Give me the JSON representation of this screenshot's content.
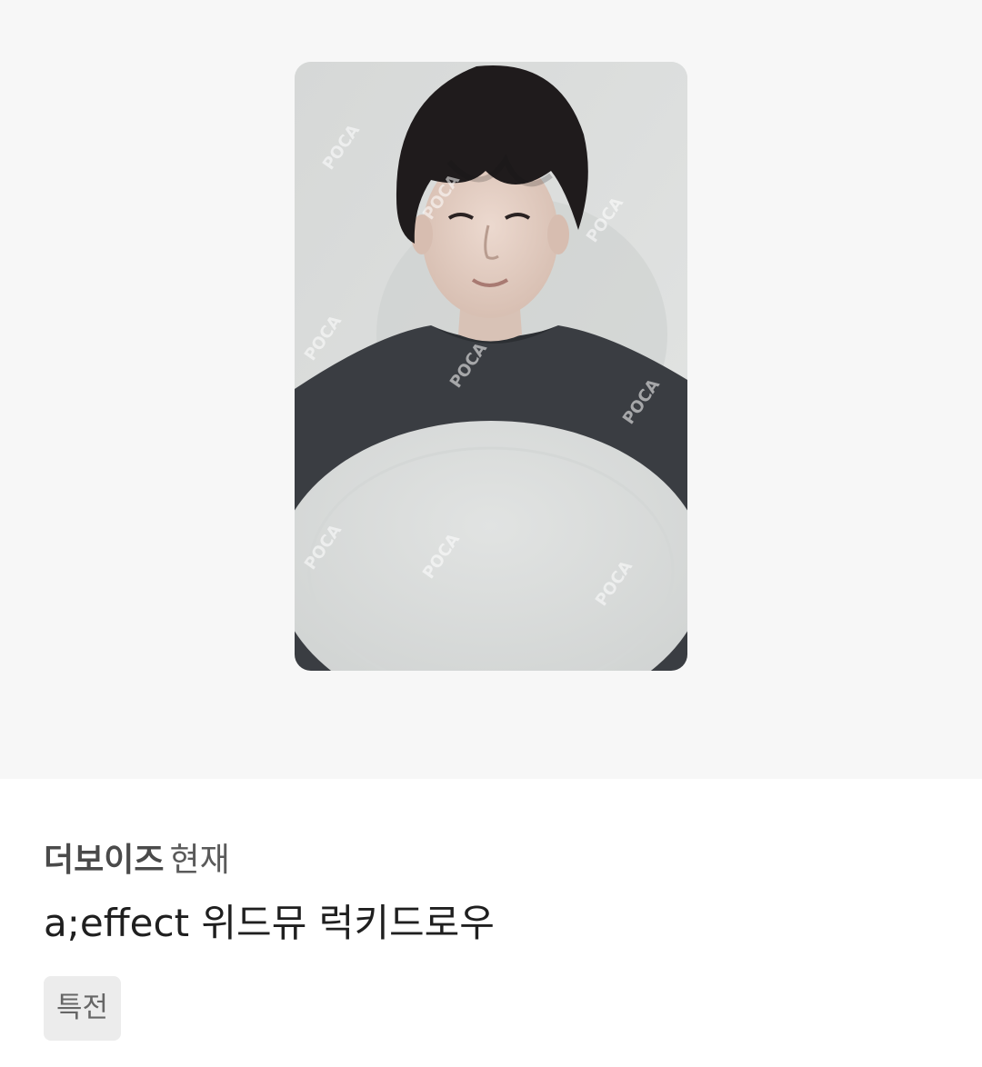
{
  "product": {
    "artist": "더보이즈",
    "member": "현재",
    "title": "a;effect 위드뮤 럭키드로우",
    "tags": [
      "특전"
    ]
  },
  "image": {
    "subject": "photocard",
    "watermark_text": "POCA"
  },
  "colors": {
    "hero_background": "#f7f7f7",
    "tag_background": "#ececec"
  }
}
